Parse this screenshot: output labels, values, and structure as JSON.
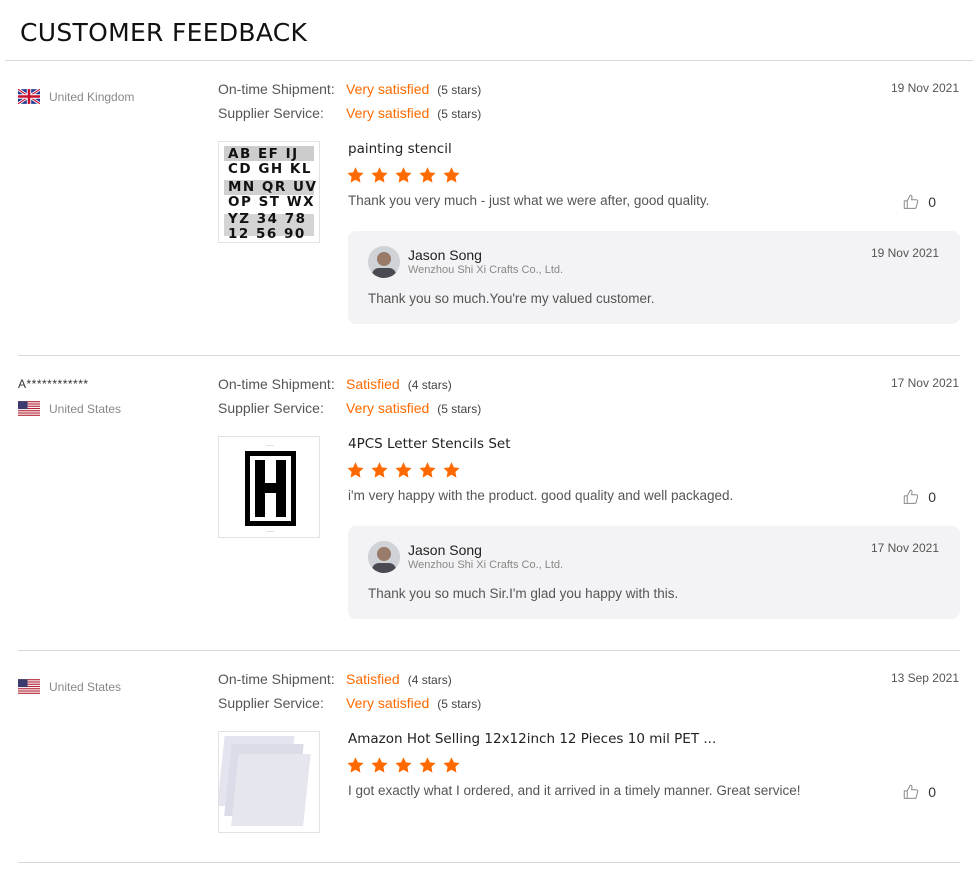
{
  "header": {
    "title": "CUSTOMER FEEDBACK"
  },
  "colors": {
    "accent": "#ff6a00",
    "reply_bg": "#f3f3f5"
  },
  "reviews": [
    {
      "buyer": "",
      "country": "United Kingdom",
      "flag": "uk-flag-icon",
      "date": "19 Nov 2021",
      "shipment_label": "On-time Shipment:",
      "shipment_value": "Very satisfied",
      "shipment_stars": "(5 stars)",
      "service_label": "Supplier Service:",
      "service_value": "Very satisfied",
      "service_stars": "(5 stars)",
      "product": "painting stencil",
      "rating": 5,
      "text": "Thank you very much - just what we were after, good quality.",
      "helpful": "0",
      "reply": {
        "name": "Jason Song",
        "company": "Wenzhou Shi Xi Crafts Co., Ltd.",
        "date": "19 Nov 2021",
        "text": "Thank you so much.You're my valued customer."
      }
    },
    {
      "buyer": "A************",
      "country": "United States",
      "flag": "us-flag-icon",
      "date": "17 Nov 2021",
      "shipment_label": "On-time Shipment:",
      "shipment_value": "Satisfied",
      "shipment_stars": "(4 stars)",
      "service_label": "Supplier Service:",
      "service_value": "Very satisfied",
      "service_stars": "(5 stars)",
      "product": "4PCS Letter Stencils Set",
      "rating": 5,
      "text": "i'm very happy with the product. good quality and well packaged.",
      "helpful": "0",
      "reply": {
        "name": "Jason Song",
        "company": "Wenzhou Shi Xi Crafts Co., Ltd.",
        "date": "17 Nov 2021",
        "text": "Thank you so much Sir.I'm glad you happy with this."
      }
    },
    {
      "buyer": "",
      "country": "United States",
      "flag": "us-flag-icon",
      "date": "13 Sep 2021",
      "shipment_label": "On-time Shipment:",
      "shipment_value": "Satisfied",
      "shipment_stars": "(4 stars)",
      "service_label": "Supplier Service:",
      "service_value": "Very satisfied",
      "service_stars": "(5 stars)",
      "product": "Amazon Hot Selling 12x12inch 12 Pieces 10 mil PET ...",
      "rating": 5,
      "text": "I got exactly what I ordered, and it arrived in a timely manner. Great service!",
      "helpful": "0"
    }
  ]
}
